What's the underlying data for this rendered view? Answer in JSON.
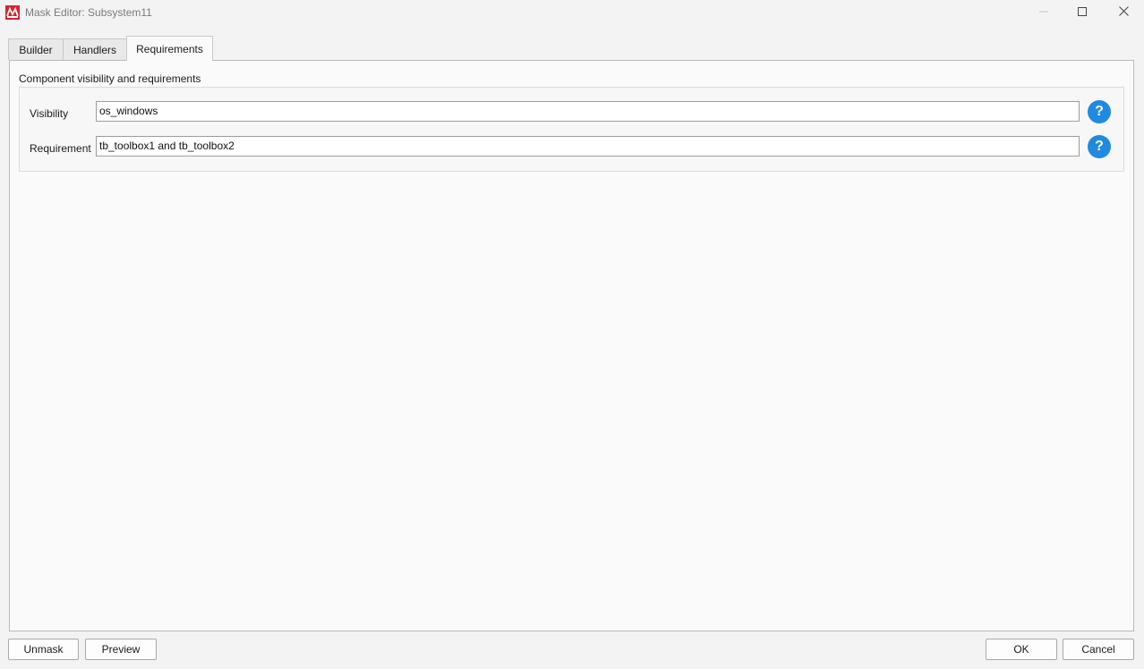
{
  "window": {
    "title": "Mask Editor: Subsystem11",
    "icon": "matlab-simulink-icon",
    "controls": [
      "minimize-icon",
      "maximize-icon",
      "close-icon"
    ]
  },
  "tabs": [
    {
      "label": "Builder",
      "active": false
    },
    {
      "label": "Handlers",
      "active": false
    },
    {
      "label": "Requirements",
      "active": true
    }
  ],
  "main": {
    "section_title": "Component visibility and requirements",
    "fields": [
      {
        "label": "Visibility",
        "value": "os_windows",
        "help": "?"
      },
      {
        "label": "Requirement",
        "value": "tb_toolbox1 and tb_toolbox2",
        "help": "?"
      }
    ]
  },
  "footer": {
    "unmask": "Unmask",
    "preview": "Preview",
    "ok": "OK",
    "cancel": "Cancel"
  },
  "colors": {
    "help_button": "#1f8ae0",
    "app_icon": "#d9232e"
  }
}
